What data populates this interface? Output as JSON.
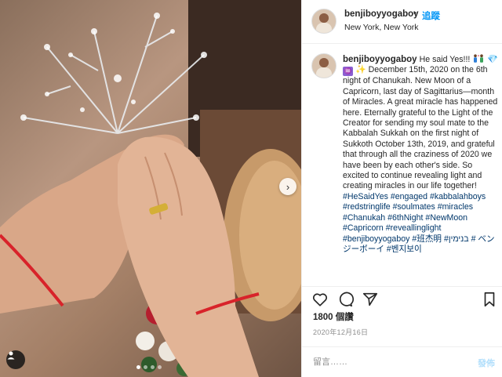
{
  "photo": {
    "description_icons": {
      "next": "chevron-right-icon",
      "tag": "person-tag-icon"
    },
    "carousel_dot_count": 4,
    "carousel_active_index": 0
  },
  "header": {
    "username": "benjiboyyogaboy",
    "separator": "•",
    "follow_label": "追蹤",
    "location": "New York, New York"
  },
  "caption": {
    "username": "benjiboyyogaboy",
    "text_lead": "He said Yes!!!",
    "text_body": "December 15th, 2020 on the 6th night of Chanukah. New Moon of a Capricorn, last day of Sagittarius—month of Miracles. A great miracle has happened here. Eternally grateful to the Light of the Creator for sending my soul mate to the Kabbalah Sukkah on the first night of Sukkoth October 13th, 2019, and grateful that through all the craziness of 2020 we have been by each other's side. So excited to continue revealing light and creating miracles in our life together!",
    "hashtags": "#HeSaidYes #engaged #kabbalahboys #redstringlife #soulmates #miracles #Chanukah #6thNight #NewMoon #Capricorn #reveallinglight #benjiboyyogaboy #班杰明 #בנימין # ベンジーボーイ #벤지보이",
    "emoji_box": "♒"
  },
  "actions": {
    "like_icon": "heart-icon",
    "comment_icon": "comment-icon",
    "share_icon": "send-icon",
    "save_icon": "bookmark-icon"
  },
  "likes_label": "1800 個讚",
  "date_label": "2020年12月16日",
  "comment": {
    "placeholder": "留言……",
    "post_label": "發佈"
  },
  "colors": {
    "accent": "#0095f6",
    "hashtag": "#00376b",
    "muted": "#8e8e8e",
    "string_red": "#d8232a"
  }
}
